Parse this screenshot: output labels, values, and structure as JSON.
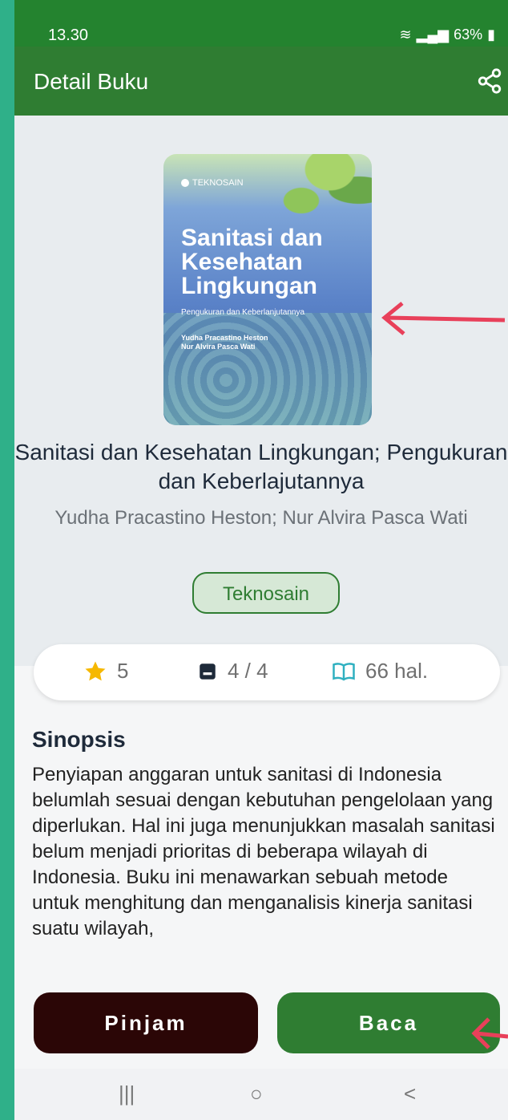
{
  "status": {
    "time": "13.30",
    "battery": "63%"
  },
  "appbar": {
    "title": "Detail Buku"
  },
  "cover": {
    "publisher": "TEKNOSAIN",
    "title": "Sanitasi dan Kesehatan Lingkungan",
    "subtitle": "Pengukuran dan Keberlanjutannya",
    "author1": "Yudha Pracastino Heston",
    "author2": "Nur Alvira Pasca Wati"
  },
  "book": {
    "title": "Sanitasi dan Kesehatan Lingkungan; Pengukuran dan Keberlajutannya",
    "authors": "Yudha Pracastino Heston; Nur Alvira Pasca Wati",
    "publisher_tag": "Teknosain"
  },
  "stats": {
    "rating": "5",
    "stock": "4 / 4",
    "pages": "66 hal."
  },
  "synopsis": {
    "heading": "Sinopsis",
    "text": "Penyiapan anggaran untuk sanitasi di Indonesia belumlah sesuai dengan kebutuhan pengelolaan yang diperlukan. Hal ini juga menunjukkan masalah sanitasi belum menjadi prioritas di beberapa wilayah di Indonesia. Buku ini menawarkan sebuah metode untuk menghitung dan menganalisis kinerja sanitasi suatu wilayah,"
  },
  "buttons": {
    "pinjam": "Pinjam",
    "baca": "Baca"
  },
  "nav": {
    "recent": "|||",
    "home": "○",
    "back": "<"
  },
  "colors": {
    "appbar": "#2f7d32",
    "pinjam": "#2b0606",
    "accent": "#2f7d32",
    "star": "#f6b800"
  }
}
